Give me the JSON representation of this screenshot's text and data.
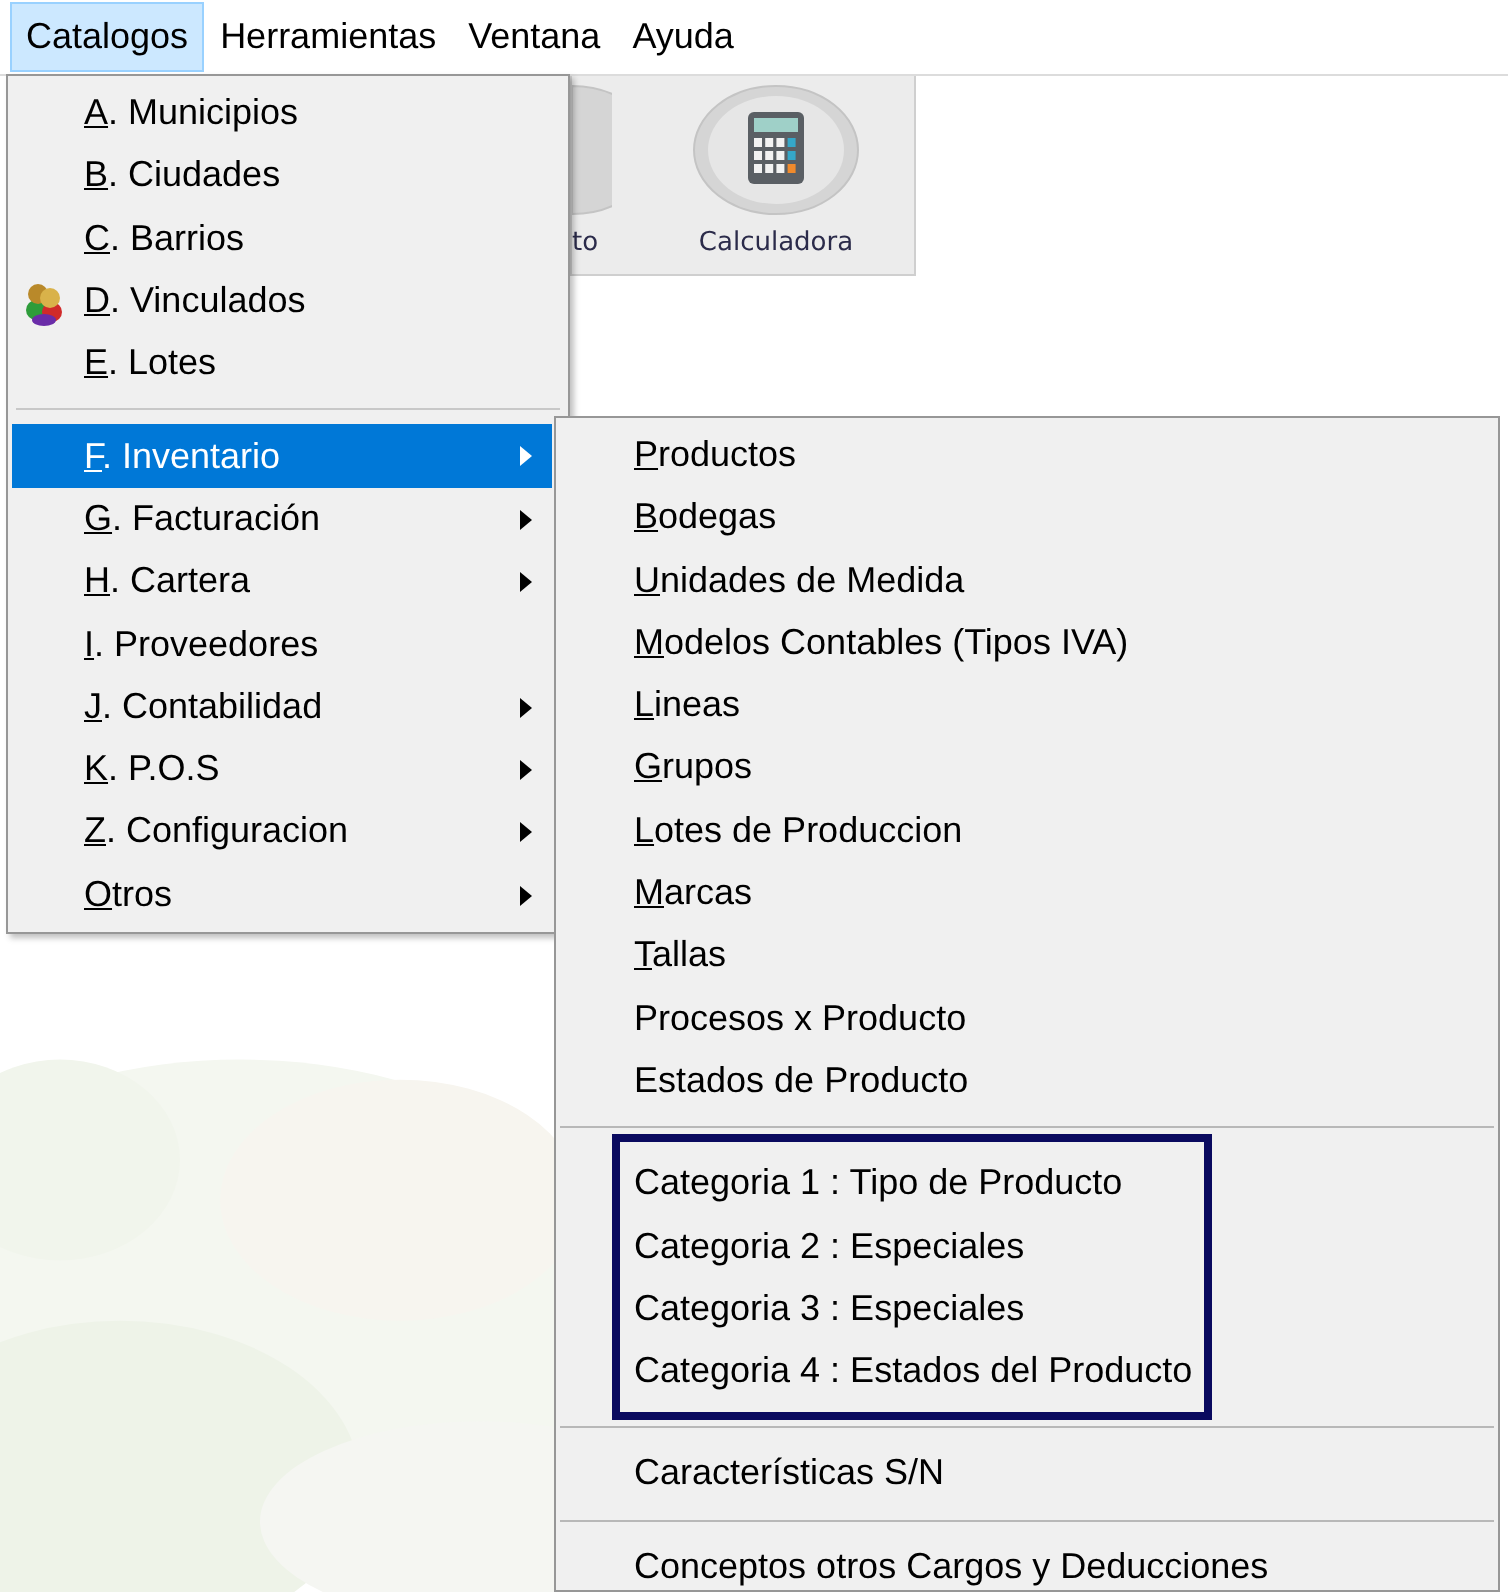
{
  "menubar": [
    {
      "label": "Catalogos",
      "selected": true
    },
    {
      "label": "Herramientas",
      "selected": false
    },
    {
      "label": "Ventana",
      "selected": false
    },
    {
      "label": "Ayuda",
      "selected": false
    }
  ],
  "toolbar": {
    "buttons": [
      {
        "label": "to",
        "cut": true
      },
      {
        "label": "Calculadora",
        "cut": false
      }
    ]
  },
  "menu": {
    "groups": [
      [
        {
          "accel": "A",
          "text": ". Municipios",
          "icon": false,
          "submenu": false,
          "selected": false
        },
        {
          "accel": "B",
          "text": ". Ciudades",
          "icon": false,
          "submenu": false,
          "selected": false
        },
        {
          "accel": "C",
          "text": ". Barrios",
          "icon": false,
          "submenu": false,
          "selected": false
        },
        {
          "accel": "D",
          "text": ". Vinculados",
          "icon": true,
          "submenu": false,
          "selected": false
        },
        {
          "accel": "E",
          "text": ". Lotes",
          "icon": false,
          "submenu": false,
          "selected": false
        }
      ],
      [
        {
          "accel": "F",
          "text": ".  Inventario",
          "icon": false,
          "submenu": true,
          "selected": true
        },
        {
          "accel": "G",
          "text": ". Facturación",
          "icon": false,
          "submenu": true,
          "selected": false
        },
        {
          "accel": "H",
          "text": ". Cartera",
          "icon": false,
          "submenu": true,
          "selected": false
        },
        {
          "accel": "I",
          "text": ".  Proveedores",
          "icon": false,
          "submenu": false,
          "selected": false
        },
        {
          "accel": "J",
          "text": ". Contabilidad",
          "icon": false,
          "submenu": true,
          "selected": false
        },
        {
          "accel": "K",
          "text": ". P.O.S",
          "icon": false,
          "submenu": true,
          "selected": false
        },
        {
          "accel": "Z",
          "text": ". Configuracion",
          "icon": false,
          "submenu": true,
          "selected": false
        },
        {
          "accel": "O",
          "text": "tros",
          "icon": false,
          "submenu": true,
          "selected": false
        }
      ]
    ]
  },
  "submenu": {
    "groups": [
      {
        "framed": false,
        "items": [
          {
            "accel": "P",
            "text": "roductos"
          },
          {
            "accel": "B",
            "text": "odegas"
          },
          {
            "accel": "U",
            "text": "nidades de Medida"
          },
          {
            "accel": "M",
            "text": "odelos Contables (Tipos IVA)"
          },
          {
            "accel": "L",
            "text": "ineas"
          },
          {
            "accel": "G",
            "text": "rupos"
          },
          {
            "accel": "L",
            "text": "otes de Produccion"
          },
          {
            "accel": "M",
            "text": "arcas"
          },
          {
            "accel": "T",
            "text": "allas"
          },
          {
            "text": "Procesos x Producto"
          },
          {
            "text": "Estados de Producto"
          }
        ]
      },
      {
        "framed": true,
        "items": [
          {
            "text": "Categoria 1 : Tipo de Producto"
          },
          {
            "text": "Categoria 2 : Especiales"
          },
          {
            "text": "Categoria 3 : Especiales"
          },
          {
            "text": "Categoria 4 : Estados del Producto"
          }
        ]
      },
      {
        "framed": false,
        "items": [
          {
            "text": "Características S/N"
          }
        ]
      },
      {
        "framed": false,
        "items": [
          {
            "text": "Conceptos otros Cargos y Deducciones"
          }
        ]
      }
    ]
  }
}
